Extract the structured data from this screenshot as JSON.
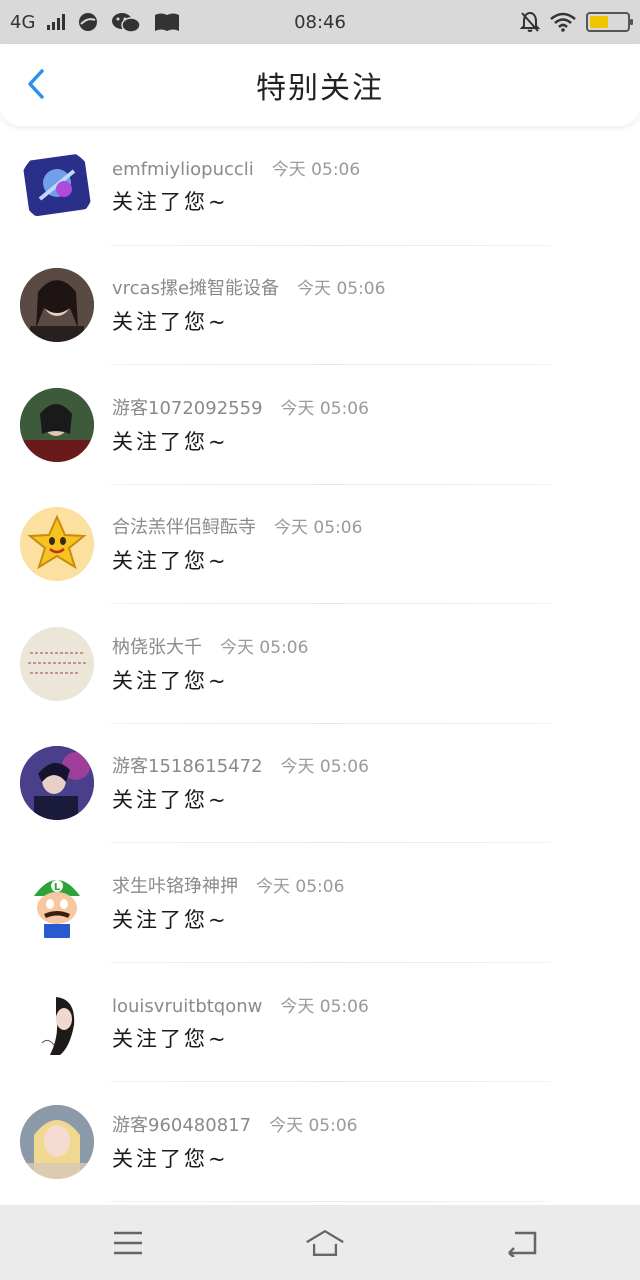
{
  "status_bar": {
    "network": "4G",
    "time": "08:46",
    "battery_level": 0.5,
    "battery_color": "#f0c400"
  },
  "header": {
    "title": "特别关注",
    "back_icon": "chevron-left-icon",
    "accent_color": "#2b8ff0"
  },
  "items": [
    {
      "user": "emfmiyliopuccli",
      "time": "今天 05:06",
      "message": "关注了您~",
      "avatar_color": "#3a3fa0"
    },
    {
      "user": "vrcas摞e摊智能设备",
      "time": "今天 05:06",
      "message": "关注了您~",
      "avatar_color": "#3b2a2a"
    },
    {
      "user": "游客1072092559",
      "time": "今天 05:06",
      "message": "关注了您~",
      "avatar_color": "#2e4a2e"
    },
    {
      "user": "合法羔伴侣鲟酝寺",
      "time": "今天 05:06",
      "message": "关注了您~",
      "avatar_color": "#f5b63a"
    },
    {
      "user": "枘侥张大千",
      "time": "今天 05:06",
      "message": "关注了您~",
      "avatar_color": "#e8e0d0"
    },
    {
      "user": "游客1518615472",
      "time": "今天 05:06",
      "message": "关注了您~",
      "avatar_color": "#3a3f7a"
    },
    {
      "user": "求生咔铬琤神押",
      "time": "今天 05:06",
      "message": "关注了您~",
      "avatar_color": "#3fa63f"
    },
    {
      "user": "louisvruitbtqonw",
      "time": "今天 05:06",
      "message": "关注了您~",
      "avatar_color": "#f2f2f2"
    },
    {
      "user": "游客960480817",
      "time": "今天 05:06",
      "message": "关注了您~",
      "avatar_color": "#c9a98a"
    }
  ],
  "nav": {
    "menu_icon": "menu-icon",
    "home_icon": "home-icon",
    "back_icon": "back-icon"
  }
}
